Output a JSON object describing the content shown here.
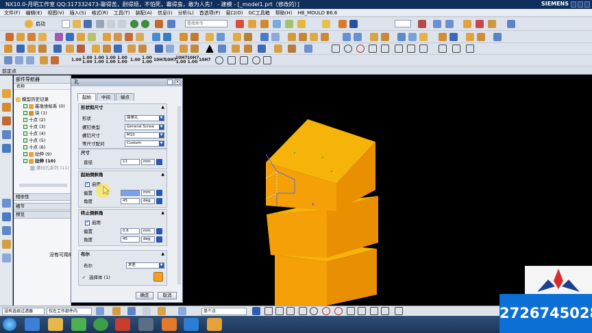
{
  "window": {
    "title": "NX10.0-月明工作室 QQ:317332473-聊得苦，耐得烦，不怕死，霸得蛮，敢为人先！ - 建模 - [_model1.prt（修改的）]",
    "brand": "SIEMENS"
  },
  "menu": {
    "items": [
      "文件(F)",
      "编辑(E)",
      "视图(V)",
      "插入(S)",
      "格式(R)",
      "工具(T)",
      "装配(A)",
      "信息(I)",
      "分析(L)",
      "首选项(P)",
      "窗口(O)",
      "GC工具箱",
      "帮助(H)",
      "HB_MOULD B6.6"
    ]
  },
  "toolbar": {
    "start_label": "启动",
    "command_search_placeholder": "查找命令",
    "dim_labels": [
      "1.00",
      "1.00 1.00",
      "1.00 1.00",
      "1.00 1.00",
      "1.00 1.00",
      "1.00",
      "1.00 1.00",
      "10H7",
      "10H7",
      "10H7 1.00",
      "10H7 1.00",
      "10H7"
    ]
  },
  "current_panel": {
    "label": "前定点"
  },
  "navigator": {
    "title": "部件导航器",
    "column_header": "名称",
    "tree": [
      {
        "label": "模型历史记录",
        "level": 0,
        "icon": "folder-icon"
      },
      {
        "label": "基准坐标系 (0)",
        "level": 1,
        "icon": "datum-csys-icon"
      },
      {
        "label": "块 (1)",
        "level": 1,
        "icon": "block-icon"
      },
      {
        "label": "十点 (2)",
        "level": 1,
        "icon": "point-icon"
      },
      {
        "label": "十点 (3)",
        "level": 1,
        "icon": "point-icon"
      },
      {
        "label": "十点 (4)",
        "level": 1,
        "icon": "point-icon"
      },
      {
        "label": "十点 (5)",
        "level": 1,
        "icon": "point-icon"
      },
      {
        "label": "十点 (6)",
        "level": 1,
        "icon": "point-icon"
      },
      {
        "label": "拉伸 (9)",
        "level": 1,
        "icon": "extrude-icon"
      },
      {
        "label": "拉伸 (10)",
        "level": 1,
        "icon": "extrude-icon"
      },
      {
        "label": "螺纹孔系列 (11)",
        "level": 1,
        "icon": "hole-icon"
      }
    ],
    "dependencies_title": "相依性",
    "details_title": "细节",
    "preview_title": "预览",
    "preview_message": "没有可用的"
  },
  "hole_dialog": {
    "title": "孔",
    "tabs": [
      "起始",
      "中间",
      "端点"
    ],
    "active_tab": "起始",
    "shape_group": {
      "title": "形状和尺寸",
      "shape_label": "形状",
      "shape_value": "简单孔",
      "thread_type_label": "螺钉类型",
      "thread_type_value": "General Screw",
      "screw_size_label": "螺钉尺寸",
      "screw_size_value": "M10",
      "fit_label": "等尺寸配对",
      "fit_value": "Custom"
    },
    "size_group": {
      "title": "尺寸",
      "diameter_label": "直径",
      "diameter_value": "11",
      "diameter_unit": "mm"
    },
    "start_chamfer": {
      "title": "起始倒斜角",
      "enable_label": "启用",
      "enabled": true,
      "offset_label": "偏置",
      "offset_value": "",
      "offset_unit": "mm",
      "angle_label": "角度",
      "angle_value": "45",
      "angle_unit": "deg"
    },
    "end_chamfer": {
      "title": "终止倒斜角",
      "enable_label": "启用",
      "enabled": true,
      "offset_label": "偏置",
      "offset_value": "0.6",
      "offset_unit": "mm",
      "angle_label": "角度",
      "angle_value": "45",
      "angle_unit": "deg"
    },
    "boolean": {
      "title": "布尔",
      "label": "布尔",
      "value": "求差",
      "select_body": "选择体 (1)"
    },
    "ok_label": "确定",
    "cancel_label": "取消"
  },
  "statusbar": {
    "filter_value": "没有选择过滤器",
    "scope_value": "仅在工作部件内",
    "snap_value": "单个点"
  },
  "overlay": {
    "phone": "2726745028"
  },
  "colors": {
    "title_bar": "#0f2f5c",
    "block_top": "#f6b40a",
    "block_front": "#f4a006",
    "block_side": "#e88f02",
    "accent_blue": "#2b58a8"
  }
}
